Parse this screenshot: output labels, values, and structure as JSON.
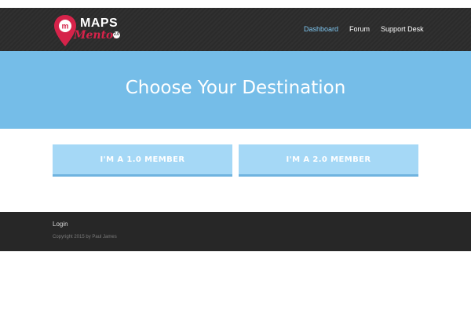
{
  "header": {
    "logo": {
      "line1": "MAPS",
      "line2": "Mentor",
      "badge": "2.0",
      "pin_letter": "m",
      "pin_color": "#d6234a"
    },
    "nav": [
      {
        "label": "Dashboard",
        "active": true
      },
      {
        "label": "Forum",
        "active": false
      },
      {
        "label": "Support Desk",
        "active": false
      }
    ]
  },
  "hero": {
    "title": "Choose Your Destination",
    "background": "#75bde8"
  },
  "choices": [
    {
      "label": "I'M A 1.0 MEMBER"
    },
    {
      "label": "I'M A 2.0 MEMBER"
    }
  ],
  "footer": {
    "login_label": "Login",
    "copyright": "Copyright 2015 by Paul James"
  },
  "colors": {
    "header_bg": "#2b2b2b",
    "nav_active": "#7ec6f0",
    "button_bg": "#a5d8f6",
    "footer_bg": "#272727"
  }
}
